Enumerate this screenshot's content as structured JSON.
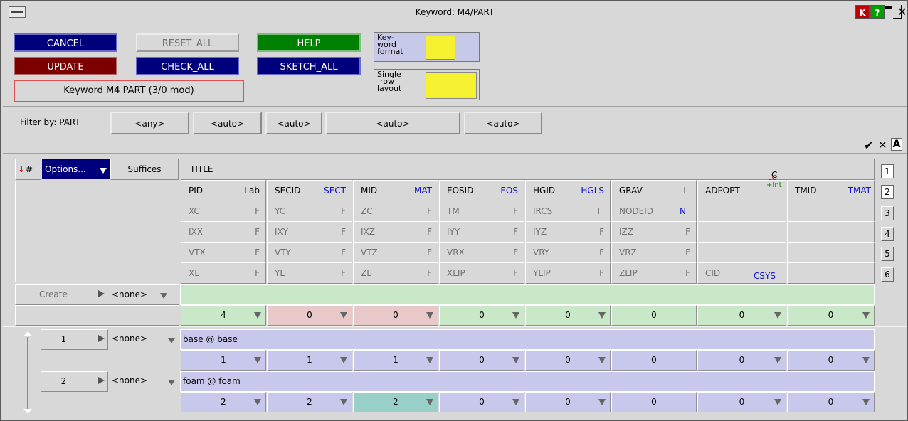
{
  "window": {
    "title": "Keyword: M4/PART"
  },
  "titlebar_buttons": {
    "k": "K",
    "help": "?",
    "minimize": "",
    "maximize": "",
    "close": "✕"
  },
  "buttons": {
    "cancel": "CANCEL",
    "reset_all": "RESET_ALL",
    "help": "HELP",
    "update": "UPDATE",
    "check_all": "CHECK_ALL",
    "sketch_all": "SKETCH_ALL"
  },
  "keyword_label": "Keyword M4 PART (3/0 mod)",
  "format_box": {
    "line1": "Key-",
    "line2": "word",
    "line3": "format"
  },
  "layout_box": {
    "line1": "Single",
    "line2": "row",
    "line3": "layout"
  },
  "filter": {
    "label": "Filter by: PART",
    "values": [
      "<any>",
      "<auto>",
      "<auto>",
      "<auto>",
      "<auto>"
    ]
  },
  "toolbar_icons": {
    "check": "✔",
    "cross": "✕",
    "a": "A"
  },
  "table_header": {
    "hash": "#",
    "options": "Options...",
    "suffices": "Suffices",
    "title": "TITLE",
    "row2": {
      "pid": "PID",
      "lab": "Lab",
      "secid": "SECID",
      "sect": "SECT",
      "mid": "MID",
      "mat": "MAT",
      "eosid": "EOSID",
      "eos": "EOS",
      "hgid": "HGID",
      "hgls": "HGLS",
      "grav": "GRAV",
      "grav_flag": "I",
      "adpopt": "ADPOPT",
      "adpopt_flag_top": "LC",
      "adpopt_flag_bottom": "+Int",
      "c_above": "C",
      "tmid": "TMID",
      "tmat": "TMAT"
    },
    "row3": {
      "xc": "XC",
      "yc": "YC",
      "zc": "ZC",
      "tm": "TM",
      "ircs": "IRCS",
      "ircs_flag": "I",
      "nodeid": "NODEID",
      "nodeid_flag": "N"
    },
    "row4": {
      "ixx": "IXX",
      "ixy": "IXY",
      "ixz": "IXZ",
      "iyy": "IYY",
      "iyz": "IYZ",
      "izz": "IZZ"
    },
    "row5": {
      "vtx": "VTX",
      "vty": "VTY",
      "vtz": "VTZ",
      "vrx": "VRX",
      "vry": "VRY",
      "vrz": "VRZ"
    },
    "row6": {
      "xl": "XL",
      "yl": "YL",
      "zl": "ZL",
      "xlip": "XLIP",
      "ylip": "YLIP",
      "zlip": "ZLIP",
      "cid": "CID",
      "csys": "CSYS"
    },
    "flag_f": "F"
  },
  "row_numbers": [
    "1",
    "2",
    "3",
    "4",
    "5",
    "6"
  ],
  "create_row": {
    "label": "Create",
    "none": "<none>",
    "values": [
      "4",
      "0",
      "0",
      "0",
      "0",
      "0",
      "0",
      "0"
    ]
  },
  "rows": [
    {
      "num": "1",
      "none": "<none>",
      "title": "base @ base",
      "values": [
        "1",
        "1",
        "1",
        "0",
        "0",
        "0",
        "0",
        "0"
      ]
    },
    {
      "num": "2",
      "none": "<none>",
      "title": "foam @ foam",
      "values": [
        "2",
        "2",
        "2",
        "0",
        "0",
        "0",
        "0",
        "0"
      ]
    }
  ],
  "colors": {
    "blue_btn": "#00007c",
    "red_btn": "#7c0000",
    "green_btn": "#008000",
    "create_row": "#c8e8c8",
    "row_bg": "#c8c8ec",
    "pink_cell": "#e8c8c8",
    "teal_cell": "#98d0c8"
  }
}
